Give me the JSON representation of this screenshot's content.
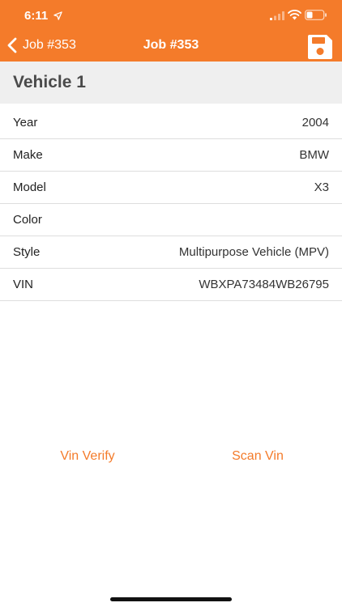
{
  "status_bar": {
    "time": "6:11"
  },
  "nav": {
    "back_label": "Job #353",
    "title": "Job #353"
  },
  "section": {
    "title": "Vehicle 1"
  },
  "fields": [
    {
      "label": "Year",
      "value": "2004"
    },
    {
      "label": "Make",
      "value": "BMW"
    },
    {
      "label": "Model",
      "value": "X3"
    },
    {
      "label": "Color",
      "value": ""
    },
    {
      "label": "Style",
      "value": "Multipurpose Vehicle (MPV)"
    },
    {
      "label": "VIN",
      "value": "WBXPA73484WB26795"
    }
  ],
  "actions": {
    "vin_verify": "Vin Verify",
    "scan_vin": "Scan Vin"
  },
  "icons": {
    "back": "chevron-left-icon",
    "save": "floppy-disk-icon",
    "location": "location-arrow-icon",
    "signal": "cellular-signal-icon",
    "wifi": "wifi-icon",
    "battery": "battery-icon"
  },
  "colors": {
    "accent": "#F47B2A",
    "section_bg": "#EFEFEF",
    "divider": "#DEDEDE"
  }
}
